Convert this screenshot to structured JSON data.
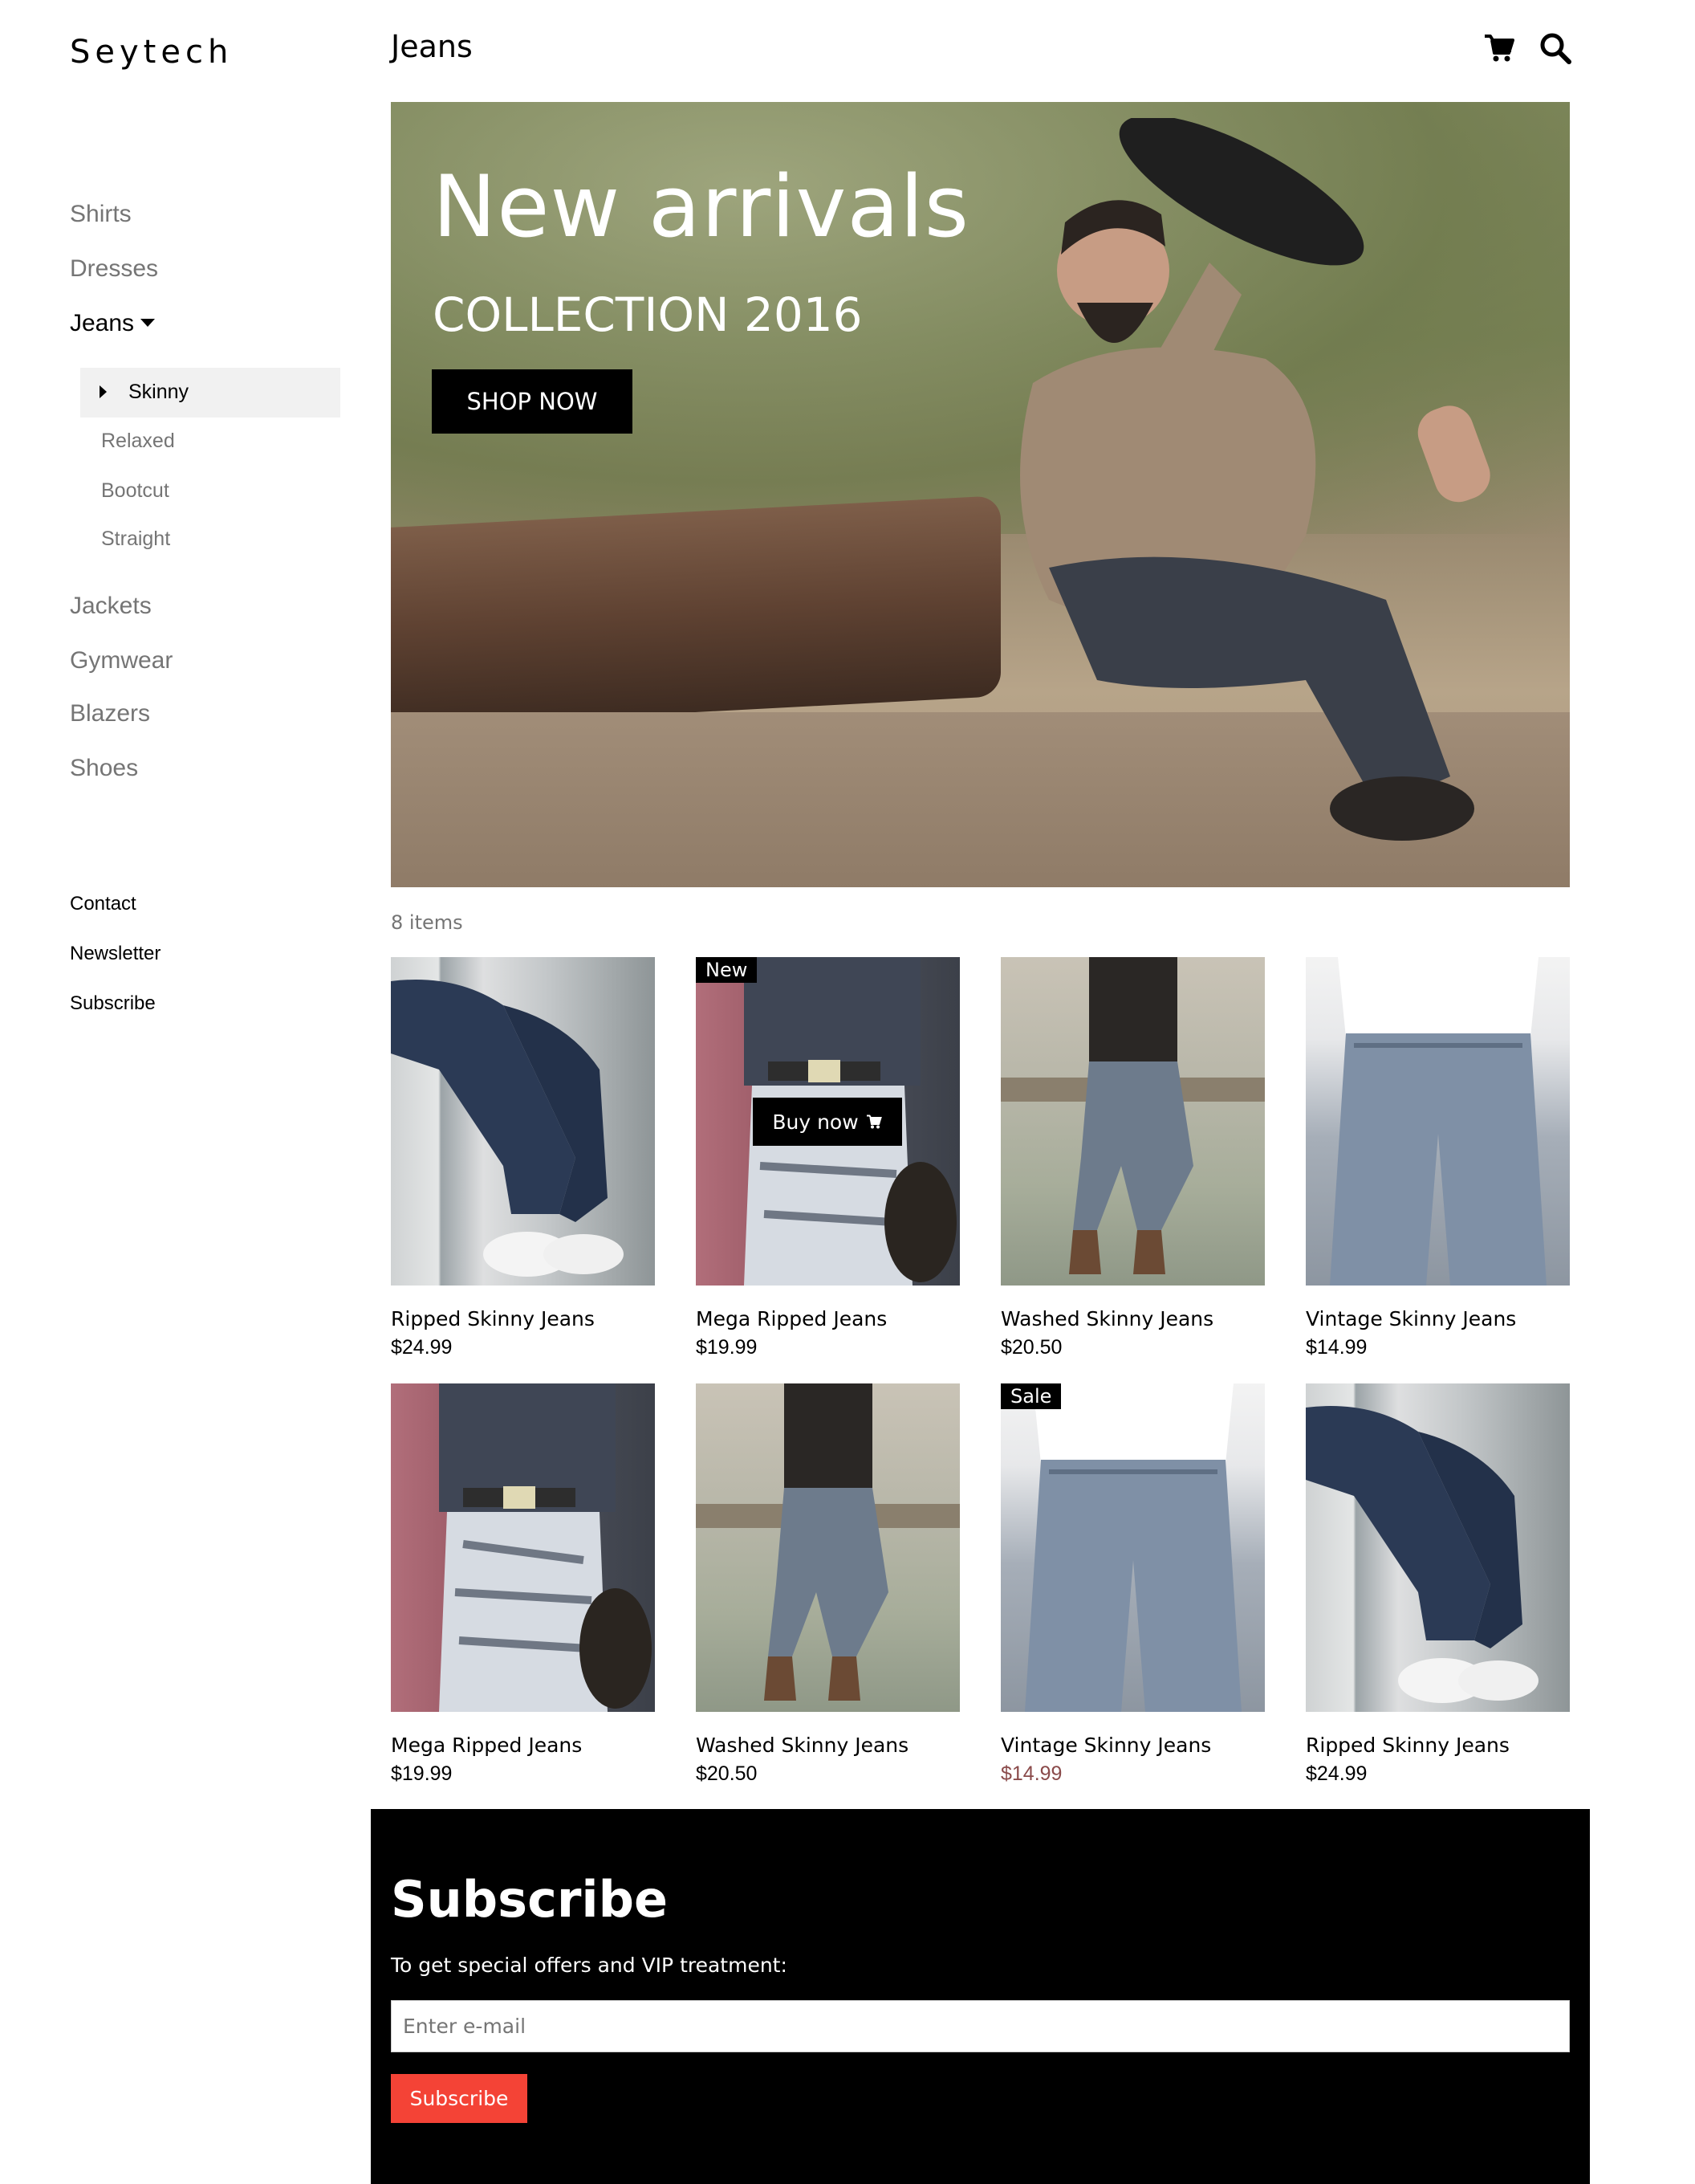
{
  "brand": "Seytech",
  "page_title": "Jeans",
  "sidebar": {
    "categories": [
      "Shirts",
      "Dresses",
      "Jeans",
      "Jackets",
      "Gymwear",
      "Blazers",
      "Shoes"
    ],
    "subcategories": [
      "Skinny",
      "Relaxed",
      "Bootcut",
      "Straight"
    ],
    "active_category": "Jeans",
    "active_subcategory": "Skinny",
    "footer_links": [
      "Contact",
      "Newsletter",
      "Subscribe"
    ]
  },
  "header_icons": [
    "cart-icon",
    "search-icon"
  ],
  "hero": {
    "title": "New arrivals",
    "subtitle": "COLLECTION 2016",
    "button": "SHOP NOW"
  },
  "item_count": "8 items",
  "products": [
    {
      "name": "Ripped Skinny Jeans",
      "price": "$24.99",
      "tag": ""
    },
    {
      "name": "Mega Ripped Jeans",
      "price": "$19.99",
      "tag": "New",
      "hover_button": "Buy now"
    },
    {
      "name": "Washed Skinny Jeans",
      "price": "$20.50",
      "tag": ""
    },
    {
      "name": "Vintage Skinny Jeans",
      "price": "$14.99",
      "tag": ""
    },
    {
      "name": "Mega Ripped Jeans",
      "price": "$19.99",
      "tag": ""
    },
    {
      "name": "Washed Skinny Jeans",
      "price": "$20.50",
      "tag": ""
    },
    {
      "name": "Vintage Skinny Jeans",
      "price": "$14.99",
      "tag": "Sale",
      "price_color": "#8a4a4a"
    },
    {
      "name": "Ripped Skinny Jeans",
      "price": "$24.99",
      "tag": ""
    }
  ],
  "subscribe": {
    "title": "Subscribe",
    "text": "To get special offers and VIP treatment:",
    "email_placeholder": "Enter e-mail",
    "button": "Subscribe"
  },
  "colors": {
    "accent": "#f44336",
    "muted_text": "#757575",
    "sale_price": "#8a4a4a",
    "active_sub_bg": "#f1f1f1"
  }
}
